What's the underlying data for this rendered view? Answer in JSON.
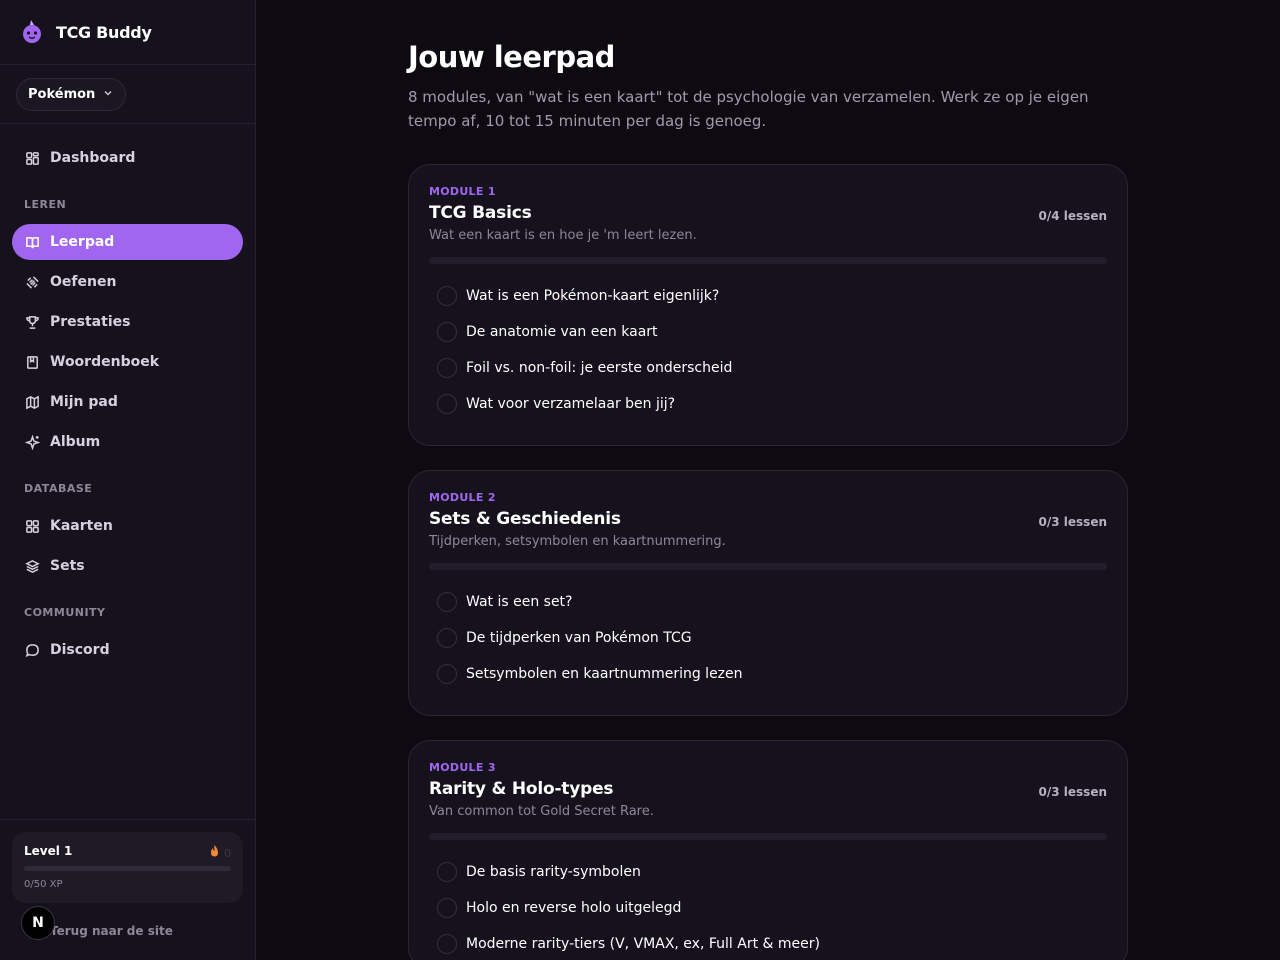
{
  "brand": {
    "name": "TCG Buddy"
  },
  "game_select": {
    "value": "Pokémon"
  },
  "nav": {
    "dashboard": "Dashboard",
    "section_leren": "LEREN",
    "leren": [
      "Leerpad",
      "Oefenen",
      "Prestaties",
      "Woordenboek",
      "Mijn pad",
      "Album"
    ],
    "section_database": "DATABASE",
    "database": [
      "Kaarten",
      "Sets"
    ],
    "section_community": "COMMUNITY",
    "community": [
      "Discord"
    ]
  },
  "level": {
    "title": "Level 1",
    "xp": "0/50 XP",
    "progress": 0,
    "streak": "0"
  },
  "footer": {
    "back": "Terug naar de site",
    "badge": "N"
  },
  "colors": {
    "accent": "#a166f0",
    "background": "#0d0b11",
    "sidebar": "#16121d"
  },
  "page": {
    "title": "Jouw leerpad",
    "subtitle": "8 modules, van \"wat is een kaart\" tot de psychologie van verzamelen. Werk ze op je eigen tempo af, 10 tot 15 minuten per dag is genoeg."
  },
  "modules": [
    {
      "label": "MODULE 1",
      "title": "TCG Basics",
      "description": "Wat een kaart is en hoe je 'm leert lezen.",
      "count": "0/4 lessen",
      "progress": 0,
      "lessons": [
        "Wat is een Pokémon-kaart eigenlijk?",
        "De anatomie van een kaart",
        "Foil vs. non-foil: je eerste onderscheid",
        "Wat voor verzamelaar ben jij?"
      ]
    },
    {
      "label": "MODULE 2",
      "title": "Sets & Geschiedenis",
      "description": "Tijdperken, setsymbolen en kaartnummering.",
      "count": "0/3 lessen",
      "progress": 0,
      "lessons": [
        "Wat is een set?",
        "De tijdperken van Pokémon TCG",
        "Setsymbolen en kaartnummering lezen"
      ]
    },
    {
      "label": "MODULE 3",
      "title": "Rarity & Holo-types",
      "description": "Van common tot Gold Secret Rare.",
      "count": "0/3 lessen",
      "progress": 0,
      "lessons": [
        "De basis rarity-symbolen",
        "Holo en reverse holo uitgelegd",
        "Moderne rarity-tiers (V, VMAX, ex, Full Art & meer)"
      ]
    }
  ]
}
